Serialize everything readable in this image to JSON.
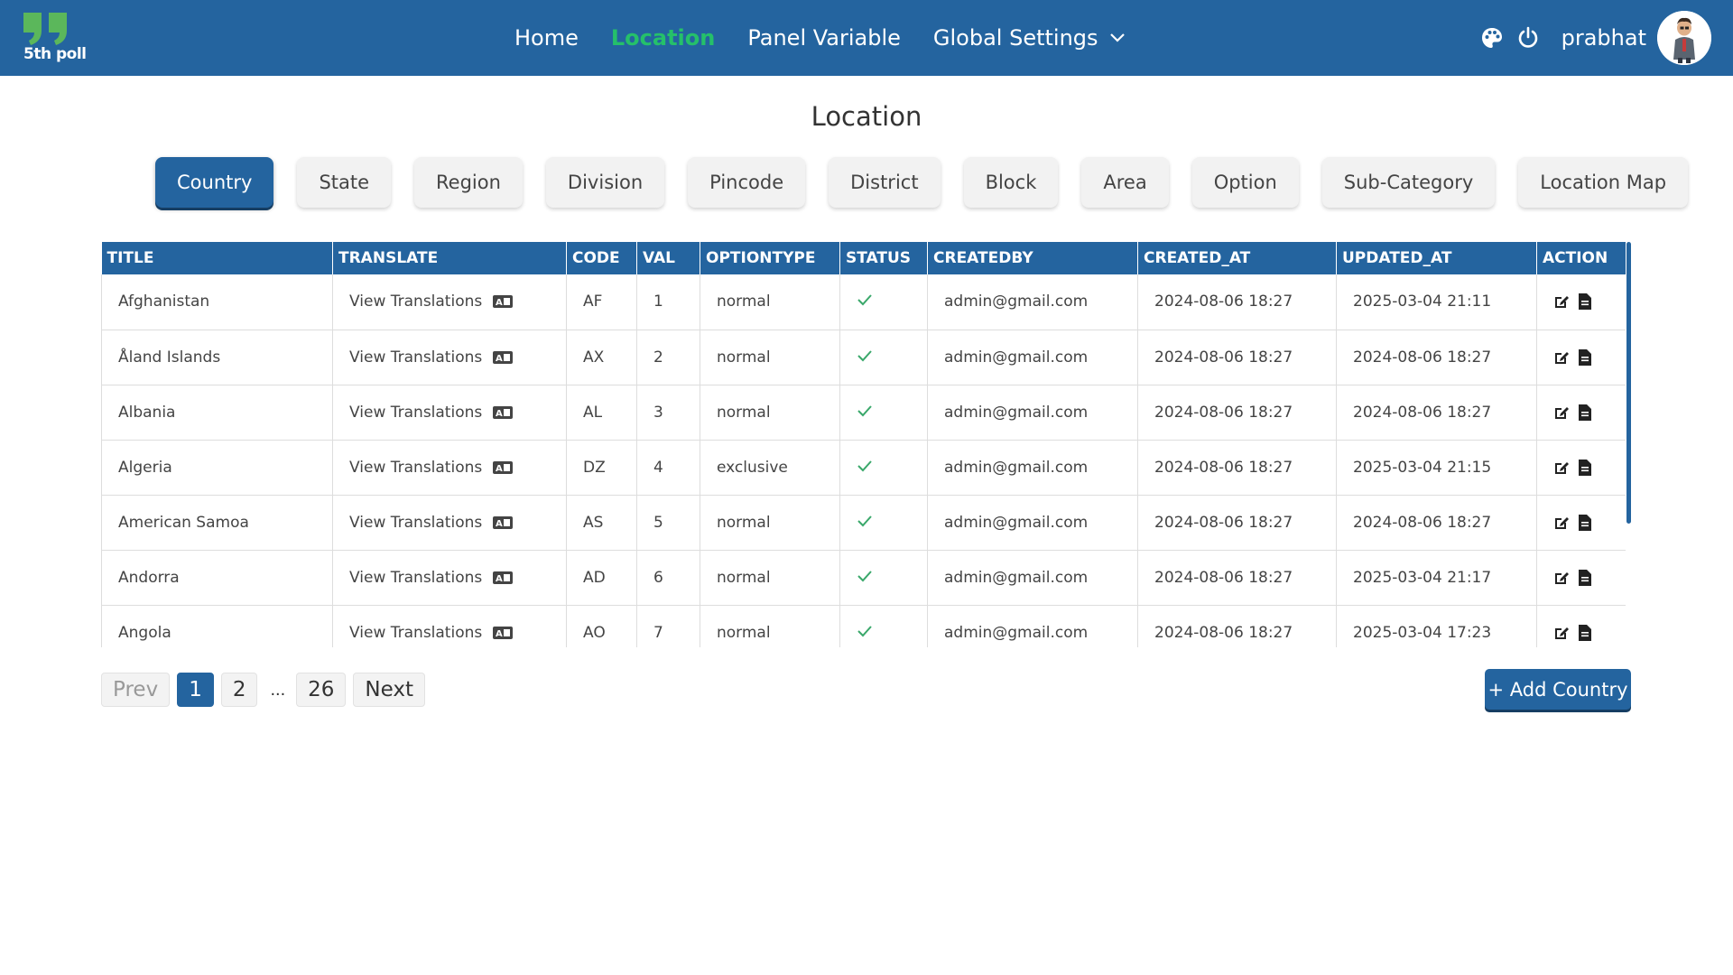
{
  "brand": {
    "name": "5th poll",
    "accent": "#25c06a",
    "primary": "#24649f"
  },
  "nav": {
    "links": [
      {
        "label": "Home"
      },
      {
        "label": "Location"
      },
      {
        "label": "Panel Variable"
      },
      {
        "label": "Global Settings"
      }
    ],
    "active": "Location",
    "icons": [
      "palette-icon",
      "power-icon"
    ],
    "username": "prabhat"
  },
  "page": {
    "title": "Location"
  },
  "tabs": [
    {
      "label": "Country"
    },
    {
      "label": "State"
    },
    {
      "label": "Region"
    },
    {
      "label": "Division"
    },
    {
      "label": "Pincode"
    },
    {
      "label": "District"
    },
    {
      "label": "Block"
    },
    {
      "label": "Area"
    },
    {
      "label": "Option"
    },
    {
      "label": "Sub-Category"
    },
    {
      "label": "Location Map"
    }
  ],
  "table": {
    "columns": [
      "TITLE",
      "TRANSLATE",
      "CODE",
      "VAL",
      "OPTIONTYPE",
      "STATUS",
      "CREATEDBY",
      "CREATED_AT",
      "UPDATED_AT",
      "ACTION"
    ],
    "rows": [
      {
        "title": "Afghanistan",
        "translate": "View Translations",
        "code": "AF",
        "val": "1",
        "optiontype": "normal",
        "status": "active",
        "createdby": "admin@gmail.com",
        "created_at": "2024-08-06 18:27",
        "updated_at": "2025-03-04 21:11"
      },
      {
        "title": "Åland Islands",
        "translate": "View Translations",
        "code": "AX",
        "val": "2",
        "optiontype": "normal",
        "status": "active",
        "createdby": "admin@gmail.com",
        "created_at": "2024-08-06 18:27",
        "updated_at": "2024-08-06 18:27"
      },
      {
        "title": "Albania",
        "translate": "View Translations",
        "code": "AL",
        "val": "3",
        "optiontype": "normal",
        "status": "active",
        "createdby": "admin@gmail.com",
        "created_at": "2024-08-06 18:27",
        "updated_at": "2024-08-06 18:27"
      },
      {
        "title": "Algeria",
        "translate": "View Translations",
        "code": "DZ",
        "val": "4",
        "optiontype": "exclusive",
        "status": "active",
        "createdby": "admin@gmail.com",
        "created_at": "2024-08-06 18:27",
        "updated_at": "2025-03-04 21:15"
      },
      {
        "title": "American Samoa",
        "translate": "View Translations",
        "code": "AS",
        "val": "5",
        "optiontype": "normal",
        "status": "active",
        "createdby": "admin@gmail.com",
        "created_at": "2024-08-06 18:27",
        "updated_at": "2024-08-06 18:27"
      },
      {
        "title": "Andorra",
        "translate": "View Translations",
        "code": "AD",
        "val": "6",
        "optiontype": "normal",
        "status": "active",
        "createdby": "admin@gmail.com",
        "created_at": "2024-08-06 18:27",
        "updated_at": "2025-03-04 21:17"
      },
      {
        "title": "Angola",
        "translate": "View Translations",
        "code": "AO",
        "val": "7",
        "optiontype": "normal",
        "status": "active",
        "createdby": "admin@gmail.com",
        "created_at": "2024-08-06 18:27",
        "updated_at": "2025-03-04 17:23"
      }
    ]
  },
  "pagination": {
    "prev": "Prev",
    "pages": [
      "1",
      "2"
    ],
    "ellipsis": "...",
    "last": "26",
    "next": "Next",
    "current": "1"
  },
  "add_button": {
    "label": "+ Add Country"
  }
}
